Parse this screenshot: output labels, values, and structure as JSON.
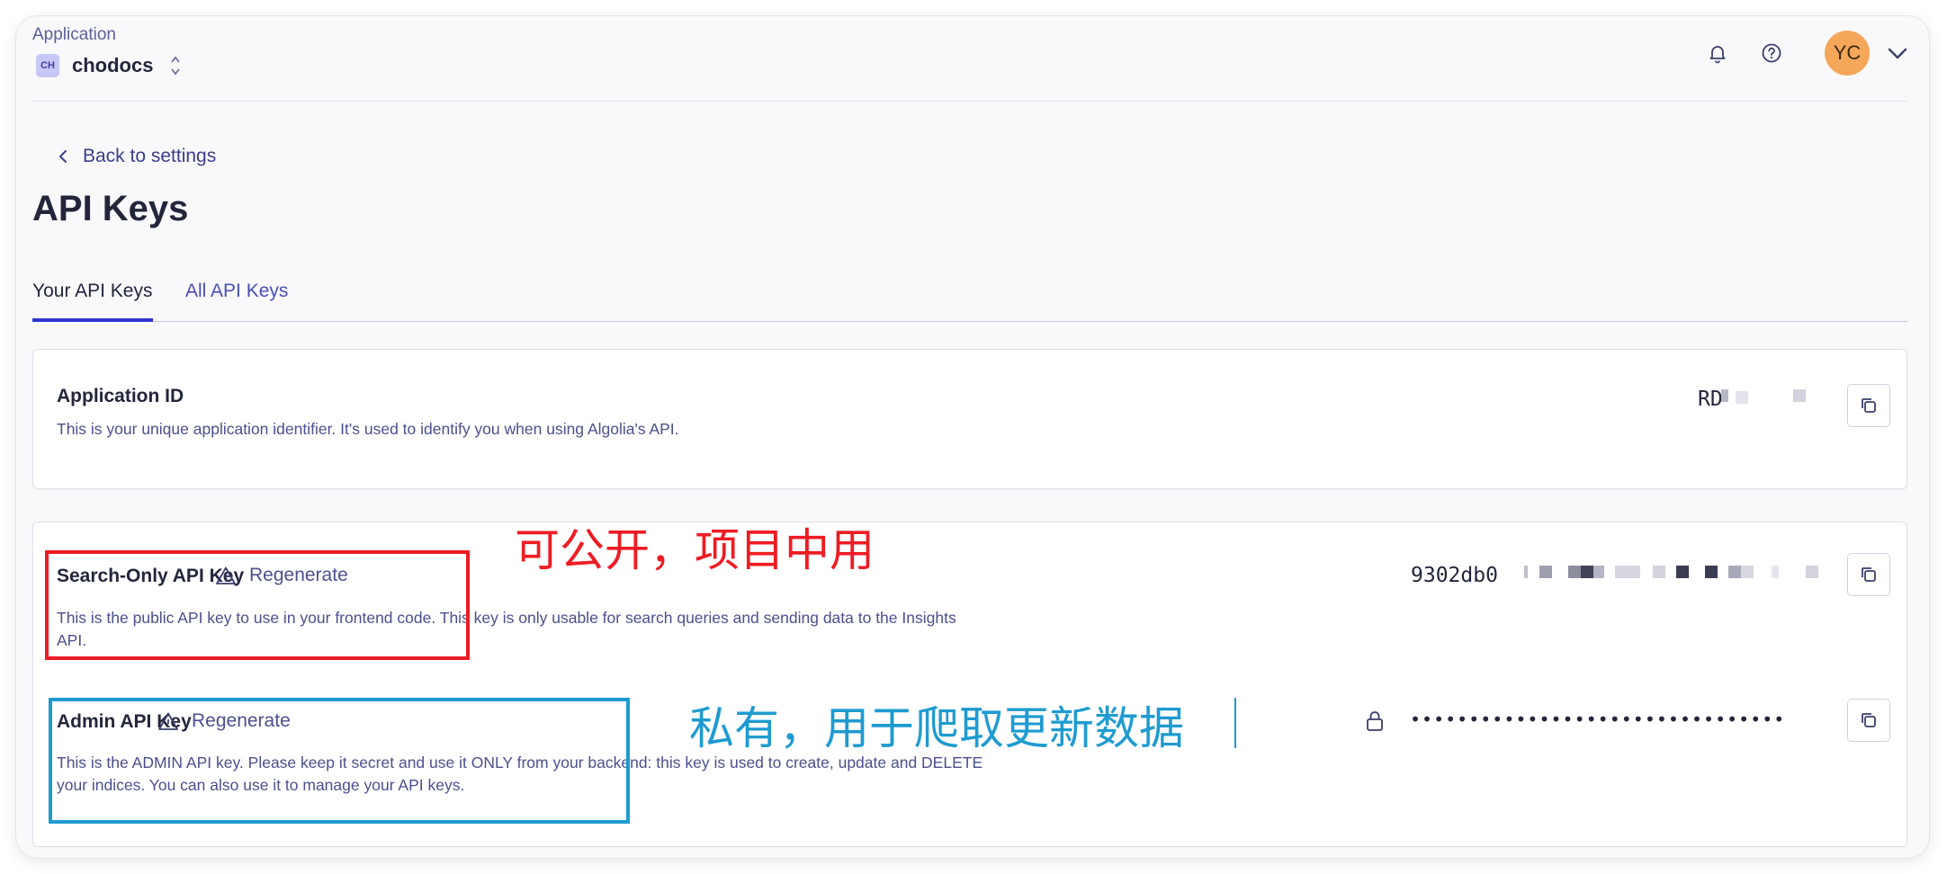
{
  "header": {
    "caption": "Application",
    "app_badge": "CH",
    "app_name": "chodocs",
    "avatar_initials": "YC"
  },
  "nav": {
    "back_label": "Back to settings"
  },
  "page": {
    "title": "API Keys"
  },
  "tabs": [
    {
      "label": "Your API Keys",
      "active": true
    },
    {
      "label": "All API Keys",
      "active": false
    }
  ],
  "application_id": {
    "title": "Application ID",
    "description": "This is your unique application identifier. It's used to identify you when using Algolia's API.",
    "value": "RD"
  },
  "search_key": {
    "title": "Search-Only API Key",
    "regenerate_label": "Regenerate",
    "description": "This is the public API key to use in your frontend code. This key is only usable for search queries and sending data to the Insights API.",
    "value": "9302db0"
  },
  "admin_key": {
    "title": "Admin API Key",
    "regenerate_label": "Regenerate",
    "description": "This is the ADMIN API key. Please keep it secret and use it ONLY from your backend: this key is used to create, update and DELETE your indices. You can also use it to manage your API keys.",
    "masked_value": "••••••••••••••••••••••••••••••••"
  },
  "annotations": {
    "search_note": "可公开，项目中用",
    "admin_note": "私有，用于爬取更新数据",
    "colors": {
      "red": "#ee1c24",
      "blue": "#1e9bd0"
    }
  },
  "icons": [
    "app-switch-chevrons-icon",
    "bell-icon",
    "help-icon",
    "chevron-down-icon",
    "chevron-left-icon",
    "warning-icon",
    "copy-icon",
    "lock-icon"
  ]
}
